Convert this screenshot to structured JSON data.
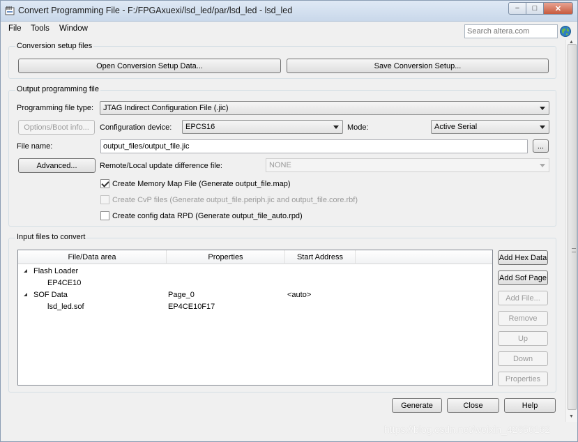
{
  "window": {
    "title": "Convert Programming File - F:/FPGAxuexi/lsd_led/par/lsd_led - lsd_led",
    "minimize_glyph": "−",
    "maximize_glyph": "□",
    "close_glyph": "✕"
  },
  "menu": {
    "file": "File",
    "tools": "Tools",
    "window": "Window",
    "search_placeholder": "Search altera.com"
  },
  "conversion_setup": {
    "group_title": "Conversion setup files",
    "open_label": "Open Conversion Setup Data...",
    "save_label": "Save Conversion Setup..."
  },
  "output": {
    "group_title": "Output programming file",
    "file_type_label": "Programming file type:",
    "file_type_value": "JTAG Indirect Configuration File (.jic)",
    "options_boot_label": "Options/Boot info...",
    "config_device_label": "Configuration device:",
    "config_device_value": "EPCS16",
    "mode_label": "Mode:",
    "mode_value": "Active Serial",
    "file_name_label": "File name:",
    "file_name_value": "output_files/output_file.jic",
    "browse_label": "...",
    "advanced_label": "Advanced...",
    "remote_local_label": "Remote/Local update difference file:",
    "remote_local_value": "NONE",
    "checkboxes": [
      {
        "label": "Create Memory Map File (Generate output_file.map)",
        "checked": true,
        "enabled": true
      },
      {
        "label": "Create CvP files (Generate output_file.periph.jic and output_file.core.rbf)",
        "checked": false,
        "enabled": false
      },
      {
        "label": "Create config data RPD (Generate output_file_auto.rpd)",
        "checked": false,
        "enabled": true
      }
    ]
  },
  "input": {
    "group_title": "Input files to convert",
    "columns": [
      "File/Data area",
      "Properties",
      "Start Address"
    ],
    "rows": [
      {
        "name": "Flash Loader",
        "properties": "",
        "start": ""
      },
      {
        "name": "EP4CE10",
        "properties": "",
        "start": ""
      },
      {
        "name": "SOF Data",
        "properties": "Page_0",
        "start": "<auto>"
      },
      {
        "name": "lsd_led.sof",
        "properties": "EP4CE10F17",
        "start": ""
      }
    ],
    "buttons": {
      "add_hex": "Add Hex Data",
      "add_sof": "Add Sof Page",
      "add_file": "Add File...",
      "remove": "Remove",
      "up": "Up",
      "down": "Down",
      "properties": "Properties"
    }
  },
  "footer": {
    "generate": "Generate",
    "close": "Close",
    "help": "Help"
  },
  "watermark": "https://blog.csdn.net/weixin_42650162",
  "colors": {
    "window_bg": "#f0f0f0",
    "titlebar": "#c9d8ea",
    "close_button": "#c75a3e"
  }
}
